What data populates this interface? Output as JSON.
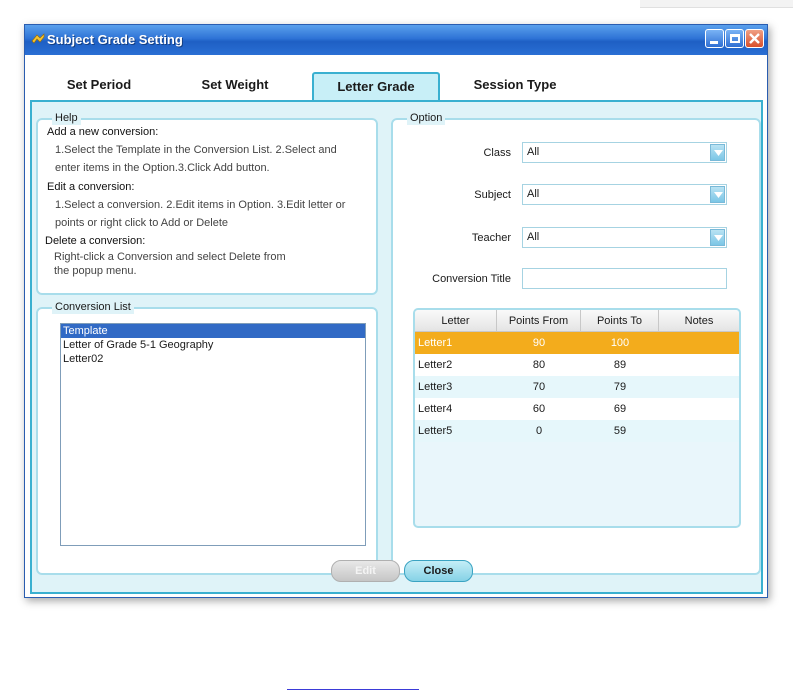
{
  "window": {
    "title": "Subject Grade Setting"
  },
  "tabs": [
    {
      "label": "Set Period",
      "active": false
    },
    {
      "label": "Set Weight",
      "active": false
    },
    {
      "label": "Letter Grade",
      "active": true
    },
    {
      "label": "Session Type",
      "active": false
    }
  ],
  "help": {
    "title": "Help",
    "sections": [
      {
        "heading": "Add a new conversion:",
        "lines": [
          "1.Select the Template in the Conversion List. 2.Select and",
          "enter items in the Option.3.Click Add button."
        ]
      },
      {
        "heading": "Edit a conversion:",
        "lines": [
          "1.Select a conversion. 2.Edit items in Option. 3.Edit letter or",
          "points or right click to Add or Delete"
        ]
      },
      {
        "heading": "Delete a conversion:",
        "lines": [
          "Right-click a Conversion and select Delete from",
          "the popup menu."
        ]
      }
    ]
  },
  "conversion_list": {
    "title": "Conversion List",
    "items": [
      "Template",
      "Letter of Grade 5-1 Geography",
      "Letter02"
    ],
    "selected_index": 0
  },
  "option": {
    "title": "Option",
    "class": {
      "label": "Class",
      "value": "All"
    },
    "subject": {
      "label": "Subject",
      "value": "All"
    },
    "teacher": {
      "label": "Teacher",
      "value": "All"
    },
    "conversion_title": {
      "label": "Conversion Title",
      "value": ""
    }
  },
  "grade_table": {
    "columns": [
      "Letter",
      "Points From",
      "Points To",
      "Notes"
    ],
    "rows": [
      {
        "letter": "Letter1",
        "from": "90",
        "to": "100",
        "notes": ""
      },
      {
        "letter": "Letter2",
        "from": "80",
        "to": "89",
        "notes": ""
      },
      {
        "letter": "Letter3",
        "from": "70",
        "to": "79",
        "notes": ""
      },
      {
        "letter": "Letter4",
        "from": "60",
        "to": "69",
        "notes": ""
      },
      {
        "letter": "Letter5",
        "from": "0",
        "to": "59",
        "notes": ""
      }
    ],
    "selected_index": 0
  },
  "buttons": {
    "edit": "Edit",
    "close": "Close"
  },
  "colors": {
    "accent": "#3ab0d0",
    "selection": "#f3ac1c",
    "list_selection": "#316ac5"
  }
}
